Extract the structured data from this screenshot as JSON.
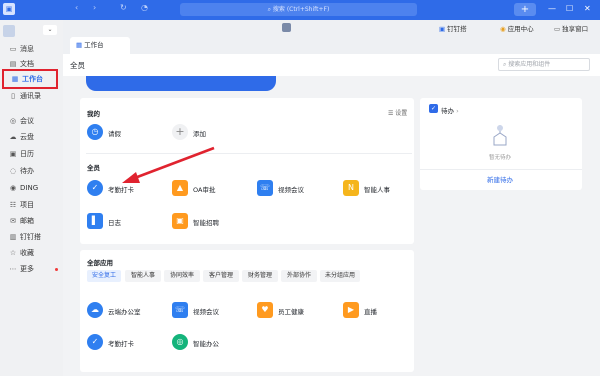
{
  "titlebar": {
    "search_placeholder": "搜索 (Ctrl+Shift+F)",
    "window_buttons": [
      "—",
      "☐",
      "✕"
    ]
  },
  "sidebar": {
    "items": [
      {
        "label": "消息",
        "icon": "message-icon"
      },
      {
        "label": "文档",
        "icon": "doc-icon"
      },
      {
        "label": "工作台",
        "icon": "workbench-icon",
        "active": true
      },
      {
        "label": "通讯录",
        "icon": "contacts-icon"
      },
      {
        "label": "会议",
        "icon": "meeting-icon"
      },
      {
        "label": "云盘",
        "icon": "cloud-disk-icon"
      },
      {
        "label": "日历",
        "icon": "calendar-icon"
      },
      {
        "label": "待办",
        "icon": "todo-icon"
      },
      {
        "label": "DING",
        "icon": "ding-icon"
      },
      {
        "label": "项目",
        "icon": "project-icon"
      },
      {
        "label": "邮箱",
        "icon": "mail-icon"
      },
      {
        "label": "钉钉搭",
        "icon": "builder-icon"
      },
      {
        "label": "收藏",
        "icon": "favorite-icon"
      },
      {
        "label": "更多",
        "icon": "more-icon"
      }
    ]
  },
  "header": {
    "dingda": "钉钉搭",
    "app_center": "应用中心",
    "exclusive": "独享窗口",
    "tab": "工作台"
  },
  "crumb": {
    "title": "全员",
    "search_placeholder": "搜索应用和组件"
  },
  "mine": {
    "title": "我的",
    "settings": "设置",
    "apps": [
      {
        "label": "请假",
        "icon": "clock-icon"
      },
      {
        "label": "添加",
        "icon": "plus-icon"
      }
    ]
  },
  "all_staff": {
    "title": "全员",
    "apps": [
      {
        "label": "考勤打卡",
        "icon": "attendance-icon",
        "color": "#2f7ff0"
      },
      {
        "label": "OA审批",
        "icon": "approval-icon",
        "color": "#ff9a1f"
      },
      {
        "label": "视频会议",
        "icon": "video-meeting-icon",
        "color": "#2f7ff0"
      },
      {
        "label": "智能人事",
        "icon": "smart-hr-icon",
        "color": "#f5b51c"
      },
      {
        "label": "日志",
        "icon": "log-icon",
        "color": "#2f7ff0"
      },
      {
        "label": "智能招聘",
        "icon": "recruit-icon",
        "color": "#ff9a1f"
      }
    ]
  },
  "all_apps": {
    "title": "全部应用",
    "chips": [
      "安全复工",
      "智能人事",
      "协同效率",
      "客户管理",
      "财务管理",
      "外部协作",
      "未分组应用"
    ],
    "apps": [
      {
        "label": "云端办公室",
        "icon": "cloud-office-icon",
        "color": "#2f7ff0"
      },
      {
        "label": "视频会议",
        "icon": "video-meeting-icon",
        "color": "#2f7ff0"
      },
      {
        "label": "员工健康",
        "icon": "health-icon",
        "color": "#ff9a1f"
      },
      {
        "label": "直播",
        "icon": "live-icon",
        "color": "#ff9a1f"
      },
      {
        "label": "考勤打卡",
        "icon": "attendance-icon",
        "color": "#2f7ff0"
      },
      {
        "label": "智能办公",
        "icon": "smart-office-icon",
        "color": "#14b47b"
      }
    ]
  },
  "todo": {
    "title": "待办",
    "empty": "暂无待办",
    "new": "新建待办"
  }
}
